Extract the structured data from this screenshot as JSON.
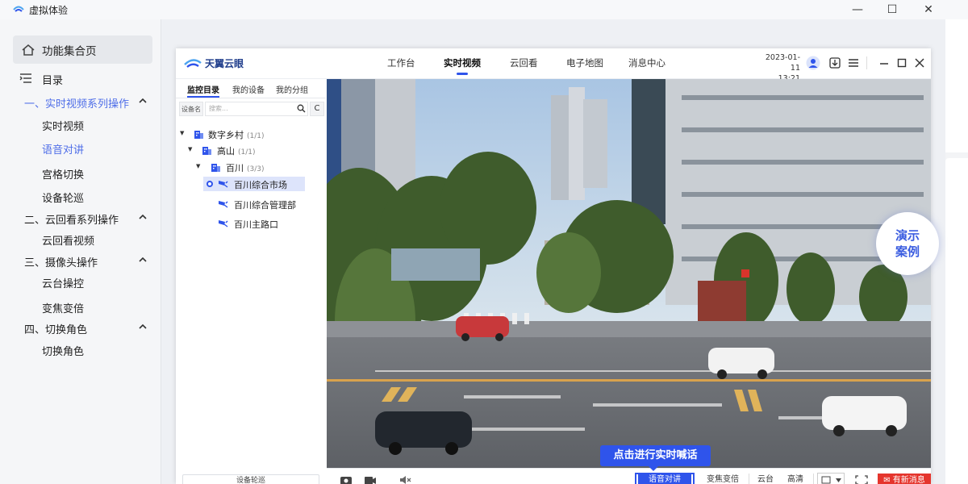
{
  "window": {
    "title": "虚拟体验",
    "controls": [
      "—",
      "☐",
      "✕"
    ]
  },
  "left_nav": {
    "home": "功能集合页",
    "catalog": "目录",
    "sections": [
      {
        "label": "一、实时视频系列操作",
        "items": [
          "实时视频",
          "语音对讲",
          "宫格切换",
          "设备轮巡"
        ]
      },
      {
        "label": "二、云回看系列操作",
        "items": [
          "云回看视频"
        ]
      },
      {
        "label": "三、摄像头操作",
        "items": [
          "云台操控",
          "变焦变倍"
        ]
      },
      {
        "label": "四、切换角色",
        "items": [
          "切换角色"
        ]
      }
    ],
    "active_item": "语音对讲"
  },
  "app": {
    "brand": "天翼云眼",
    "nav_tabs": [
      "工作台",
      "实时视频",
      "云回看",
      "电子地图",
      "消息中心"
    ],
    "active_tab": "实时视频",
    "date": "2023-01-11",
    "time": "13:21",
    "side_tabs": [
      "监控目录",
      "我的设备",
      "我的分组"
    ],
    "active_side_tab": "监控目录",
    "search": {
      "select_label": "设备名",
      "placeholder": "搜索...",
      "refresh_label": "C"
    },
    "tree": [
      {
        "name": "数字乡村",
        "count": "(1/1)",
        "level": 0
      },
      {
        "name": "高山",
        "count": "(1/1)",
        "level": 1
      },
      {
        "name": "百川",
        "count": "(3/3)",
        "level": 2
      },
      {
        "name": "百川综合市场",
        "count": "",
        "level": 3
      },
      {
        "name": "百川综合管理部",
        "count": "",
        "level": 3
      },
      {
        "name": "百川主路口",
        "count": "",
        "level": 3
      }
    ],
    "selected_node": "百川综合市场",
    "patrol_button": "设备轮巡",
    "toolbar": {
      "talk": "语音对讲",
      "zoom": "变焦变倍",
      "ptz": "云台",
      "hd": "高清",
      "alert": "有新消息"
    },
    "tip": "点击进行实时喊话"
  },
  "demo_badge": {
    "line1": "演示",
    "line2": "案例"
  },
  "colors": {
    "accent": "#2f54eb",
    "nav_active": "#4f6ee8",
    "alert": "#e5352d"
  }
}
